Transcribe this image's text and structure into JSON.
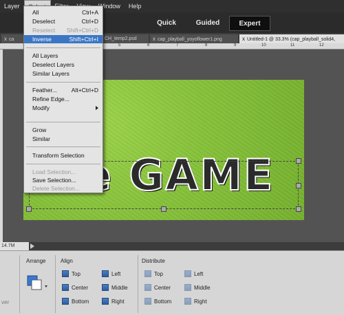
{
  "menubar": {
    "items": [
      "Layer",
      "Select",
      "Filter",
      "View",
      "Window",
      "Help"
    ]
  },
  "modes": {
    "quick": "Quick",
    "guided": "Guided",
    "expert": "Expert"
  },
  "tabs": [
    {
      "label": "ca"
    },
    {
      "label": "CH_temp2.psd"
    },
    {
      "label": "cap_playball_yoyoflower1.png"
    },
    {
      "label": "Untitled-1 @ 33.3% (cap_playball_solid4,"
    }
  ],
  "ruler": {
    "ticks": [
      "5",
      "6",
      "7",
      "8",
      "9",
      "10",
      "11",
      "12"
    ]
  },
  "canvas": {
    "text": "the GAME"
  },
  "status": {
    "size": "14.7M"
  },
  "select_menu": {
    "items": [
      {
        "label": "All",
        "shortcut": "Ctrl+A",
        "disabled": false
      },
      {
        "label": "Deselect",
        "shortcut": "Ctrl+D",
        "disabled": false
      },
      {
        "label": "Reselect",
        "shortcut": "Shift+Ctrl+D",
        "disabled": true
      },
      {
        "label": "Inverse",
        "shortcut": "Shift+Ctrl+I",
        "disabled": false,
        "highlight": true
      },
      {
        "label": "All Layers",
        "shortcut": "",
        "disabled": false
      },
      {
        "label": "Deselect Layers",
        "shortcut": "",
        "disabled": false
      },
      {
        "label": "Similar Layers",
        "shortcut": "",
        "disabled": false
      },
      {
        "label": "Feather...",
        "shortcut": "Alt+Ctrl+D",
        "disabled": false
      },
      {
        "label": "Refine Edge...",
        "shortcut": "",
        "disabled": false
      },
      {
        "label": "Modify",
        "shortcut": "",
        "disabled": false,
        "submenu": true
      },
      {
        "label": "Grow",
        "shortcut": "",
        "disabled": false
      },
      {
        "label": "Similar",
        "shortcut": "",
        "disabled": false
      },
      {
        "label": "Transform Selection",
        "shortcut": "",
        "disabled": false
      },
      {
        "label": "Load Selection...",
        "shortcut": "",
        "disabled": true
      },
      {
        "label": "Save Selection...",
        "shortcut": "",
        "disabled": false
      },
      {
        "label": "Delete Selection...",
        "shortcut": "",
        "disabled": true
      }
    ]
  },
  "options": {
    "arrange_label": "Arrange",
    "align_label": "Align",
    "distribute_label": "Distribute",
    "layer_label": "ver",
    "align": {
      "top": "Top",
      "center": "Center",
      "bottom": "Bottom",
      "left": "Left",
      "middle": "Middle",
      "right": "Right"
    },
    "distribute": {
      "top": "Top",
      "center": "Center",
      "bottom": "Bottom",
      "left": "Left",
      "middle": "Middle",
      "right": "Right"
    }
  },
  "colors": {
    "highlight": "#3b76c5",
    "expert_bg": "#0f0f0f",
    "canvas_green": "#86c23a"
  }
}
